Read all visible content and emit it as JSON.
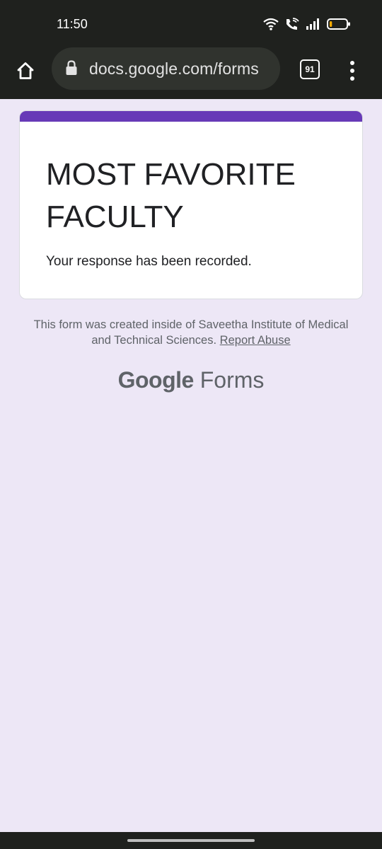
{
  "status_bar": {
    "time": "11:50",
    "icons": [
      "wifi-icon",
      "wifi-calling-icon",
      "signal-icon",
      "battery-icon"
    ],
    "battery_level": 0.15,
    "battery_color": "#f9ab00"
  },
  "browser": {
    "url": "docs.google.com/forms",
    "tab_count": "91",
    "icons": [
      "home-icon",
      "lock-icon",
      "tabs-icon",
      "more-vert-icon"
    ]
  },
  "form": {
    "title": "MOST FAVORITE FACULTY",
    "confirmation": "Your response has been recorded.",
    "accent_color": "#673ab7"
  },
  "footer": {
    "note": "This form was created inside of Saveetha Institute of Medical and Technical Sciences.",
    "report_link": "Report Abuse",
    "logo_google": "Google",
    "logo_forms": "Forms"
  },
  "colors": {
    "page_background": "#ede7f6",
    "chrome_background": "#1f211e",
    "url_pill": "#30332e"
  }
}
